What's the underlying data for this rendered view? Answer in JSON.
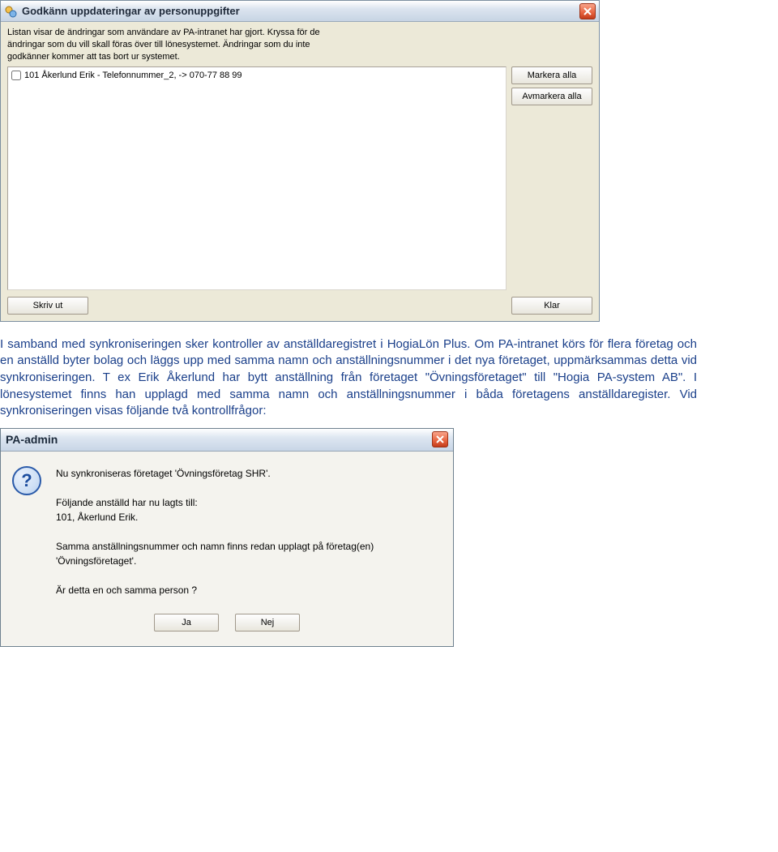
{
  "dialog1": {
    "title": "Godkänn uppdateringar av personuppgifter",
    "instructions": "Listan visar de ändringar som användare av PA-intranet har gjort. Kryssa för de\nändringar som du vill skall föras över till lönesystemet. Ändringar som du inte\ngodkänner kommer att tas bort ur systemet.",
    "list_items": [
      "101  Åkerlund Erik - Telefonnummer_2,  -> 070-77 88 99"
    ],
    "buttons": {
      "mark_all": "Markera alla",
      "unmark_all": "Avmarkera alla",
      "print": "Skriv ut",
      "done": "Klar"
    }
  },
  "paragraph": "I samband med synkroniseringen sker kontroller av anställdaregistret i HogiaLön Plus. Om PA-intranet körs för flera företag och en anställd byter bolag och läggs upp med samma namn och anställningsnummer i det nya företaget, uppmärksammas detta vid synkroniseringen. T ex Erik Åkerlund har bytt anställning från företaget \"Övningsföretaget\" till \"Hogia PA-system AB\". I lönesystemet finns han upplagd med samma namn och anställningsnummer i båda företagens anställdaregister. Vid synkroniseringen visas följande två kontrollfrågor:",
  "dialog2": {
    "title": "PA-admin",
    "message": "Nu synkroniseras företaget 'Övningsföretag SHR'.\n\nFöljande anställd har nu lagts till:\n101, Åkerlund Erik.\n\nSamma anställningsnummer och namn finns redan upplagt på företag(en)\n'Övningsföretaget'.\n\nÄr detta en och samma person ?",
    "buttons": {
      "yes": "Ja",
      "no": "Nej"
    }
  }
}
